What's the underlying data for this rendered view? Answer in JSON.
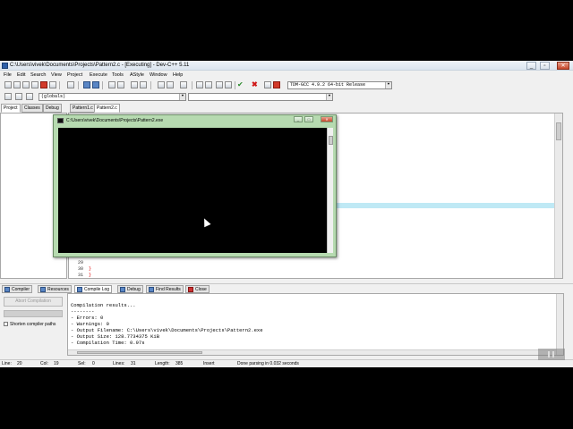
{
  "window": {
    "title": "C:\\Users\\vivek\\Documents\\Projects\\Pattern2.c - [Executing] - Dev-C++ 5.11",
    "min_label": "_",
    "max_label": "▫",
    "close_label": "✕"
  },
  "menu": [
    "File",
    "Edit",
    "Search",
    "View",
    "Project",
    "Execute",
    "Tools",
    "AStyle",
    "Window",
    "Help"
  ],
  "toolbar": {
    "compiler_combo": "TDM-GCC 4.9.2 64-bit Release",
    "scope_combo": "(globals)"
  },
  "left_tabs": [
    "Project",
    "Classes",
    "Debug"
  ],
  "file_tabs": [
    "Pattern1.c",
    "Pattern2.c"
  ],
  "editor": {
    "line_numbers": [
      "29",
      "30",
      "31"
    ],
    "braces": [
      "}",
      "}"
    ]
  },
  "console": {
    "title": "C:\\Users\\vivek\\Documents\\Projects\\Pattern2.exe"
  },
  "bottom_tabs": [
    "Compiler",
    "Resources",
    "Compile Log",
    "Debug",
    "Find Results",
    "Close"
  ],
  "compile_panel": {
    "abort_label": "Abort Compilation",
    "shorten_label": "Shorten compiler paths"
  },
  "log_lines": [
    "Compilation results...",
    "--------",
    "- Errors: 0",
    "- Warnings: 0",
    "- Output Filename: C:\\Users\\vivek\\Documents\\Projects\\Pattern2.exe",
    "- Output Size: 128.7734375 KiB",
    "- Compilation Time: 0.97s"
  ],
  "status": {
    "line_label": "Line:",
    "line_value": "20",
    "col_label": "Col:",
    "col_value": "19",
    "sel_label": "Sel:",
    "sel_value": "0",
    "lines_label": "Lines:",
    "lines_value": "31",
    "length_label": "Length:",
    "length_value": "385",
    "mode": "Insert",
    "message": "Done parsing in 0.032 seconds"
  },
  "colors": {
    "console_frame": "#b6dab0",
    "highlight_line": "#bfe9f5",
    "close_red": "#c7472a"
  }
}
